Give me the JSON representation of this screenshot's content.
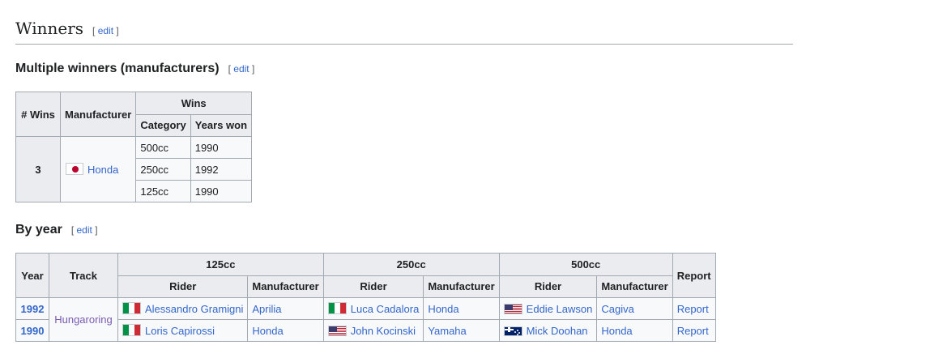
{
  "section": {
    "title": "Winners",
    "edit_label": "edit"
  },
  "manufacturers": {
    "title": "Multiple winners (manufacturers)",
    "edit_label": "edit",
    "headers": {
      "wins_count": "# Wins",
      "manufacturer": "Manufacturer",
      "wins": "Wins",
      "category": "Category",
      "years_won": "Years won"
    },
    "row": {
      "wins_count": "3",
      "manufacturer": "Honda",
      "flag_icon": "japan-flag-icon",
      "entries": [
        {
          "category": "500cc",
          "years": "1990"
        },
        {
          "category": "250cc",
          "years": "1992"
        },
        {
          "category": "125cc",
          "years": "1990"
        }
      ]
    }
  },
  "by_year": {
    "title": "By year",
    "edit_label": "edit",
    "headers": {
      "year": "Year",
      "track": "Track",
      "class_125": "125cc",
      "class_250": "250cc",
      "class_500": "500cc",
      "report": "Report",
      "rider": "Rider",
      "manufacturer": "Manufacturer"
    },
    "track": "Hungaroring",
    "rows": [
      {
        "year": "1992",
        "r125": {
          "rider": "Alessandro Gramigni",
          "flag": "italy-flag-icon",
          "manufacturer": "Aprilia"
        },
        "r250": {
          "rider": "Luca Cadalora",
          "flag": "italy-flag-icon",
          "manufacturer": "Honda"
        },
        "r500": {
          "rider": "Eddie Lawson",
          "flag": "usa-flag-icon",
          "manufacturer": "Cagiva"
        },
        "report": "Report"
      },
      {
        "year": "1990",
        "r125": {
          "rider": "Loris Capirossi",
          "flag": "italy-flag-icon",
          "manufacturer": "Honda"
        },
        "r250": {
          "rider": "John Kocinski",
          "flag": "usa-flag-icon",
          "manufacturer": "Yamaha"
        },
        "r500": {
          "rider": "Mick Doohan",
          "flag": "australia-flag-icon",
          "manufacturer": "Honda"
        },
        "report": "Report"
      }
    ]
  }
}
